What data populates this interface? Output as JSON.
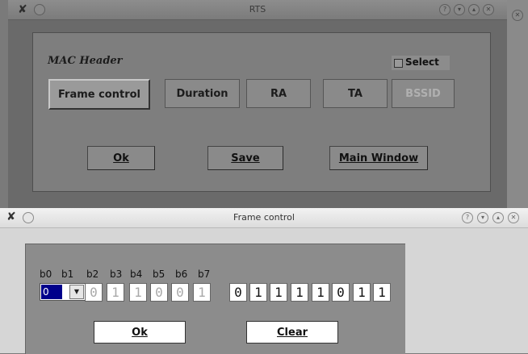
{
  "rts_window": {
    "title": "RTS",
    "header_label": "MAC Header",
    "select_label": "Select",
    "field_buttons": [
      {
        "label": "Frame control"
      },
      {
        "label": "Duration"
      },
      {
        "label": "RA"
      },
      {
        "label": "TA"
      },
      {
        "label": "BSSID"
      }
    ],
    "ok_label": "Ok",
    "save_label": "Save",
    "main_window_label": "Main Window"
  },
  "frame_control_window": {
    "title": "Frame control",
    "bit_labels": [
      "b0",
      "b1",
      "b2",
      "b3",
      "b4",
      "b5",
      "b6",
      "b7"
    ],
    "combo_value": "0",
    "first_byte": [
      "0",
      "1",
      "1",
      "0",
      "0",
      "1"
    ],
    "second_byte": [
      "0",
      "1",
      "1",
      "1",
      "1",
      "0",
      "1",
      "1"
    ],
    "ok_label": "Ok",
    "clear_label": "Clear"
  },
  "colors": {
    "selected_combo": "#00008b",
    "panel": "#7e7e7e",
    "disabled_text": "#b0b0b0"
  }
}
